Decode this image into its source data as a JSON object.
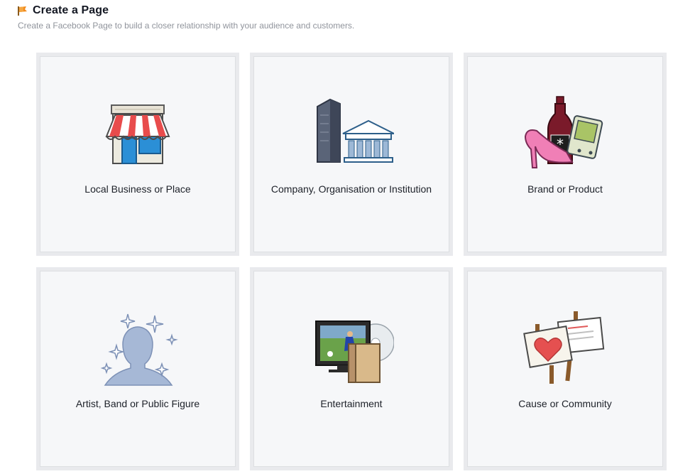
{
  "header": {
    "title": "Create a Page",
    "subtitle": "Create a Facebook Page to build a closer relationship with your audience and customers.",
    "icon": "flag-icon"
  },
  "categories": [
    {
      "label": "Local Business or Place",
      "icon": "storefront-icon"
    },
    {
      "label": "Company, Organisation or Institution",
      "icon": "buildings-icon"
    },
    {
      "label": "Brand or Product",
      "icon": "products-icon"
    },
    {
      "label": "Artist, Band or Public Figure",
      "icon": "person-sparkle-icon"
    },
    {
      "label": "Entertainment",
      "icon": "media-icon"
    },
    {
      "label": "Cause or Community",
      "icon": "protest-signs-icon"
    }
  ],
  "colors": {
    "card_bg": "#f6f7f9",
    "card_border": "#e9eaed",
    "title": "#141823",
    "subtitle": "#90949c",
    "label": "#1d2129"
  }
}
